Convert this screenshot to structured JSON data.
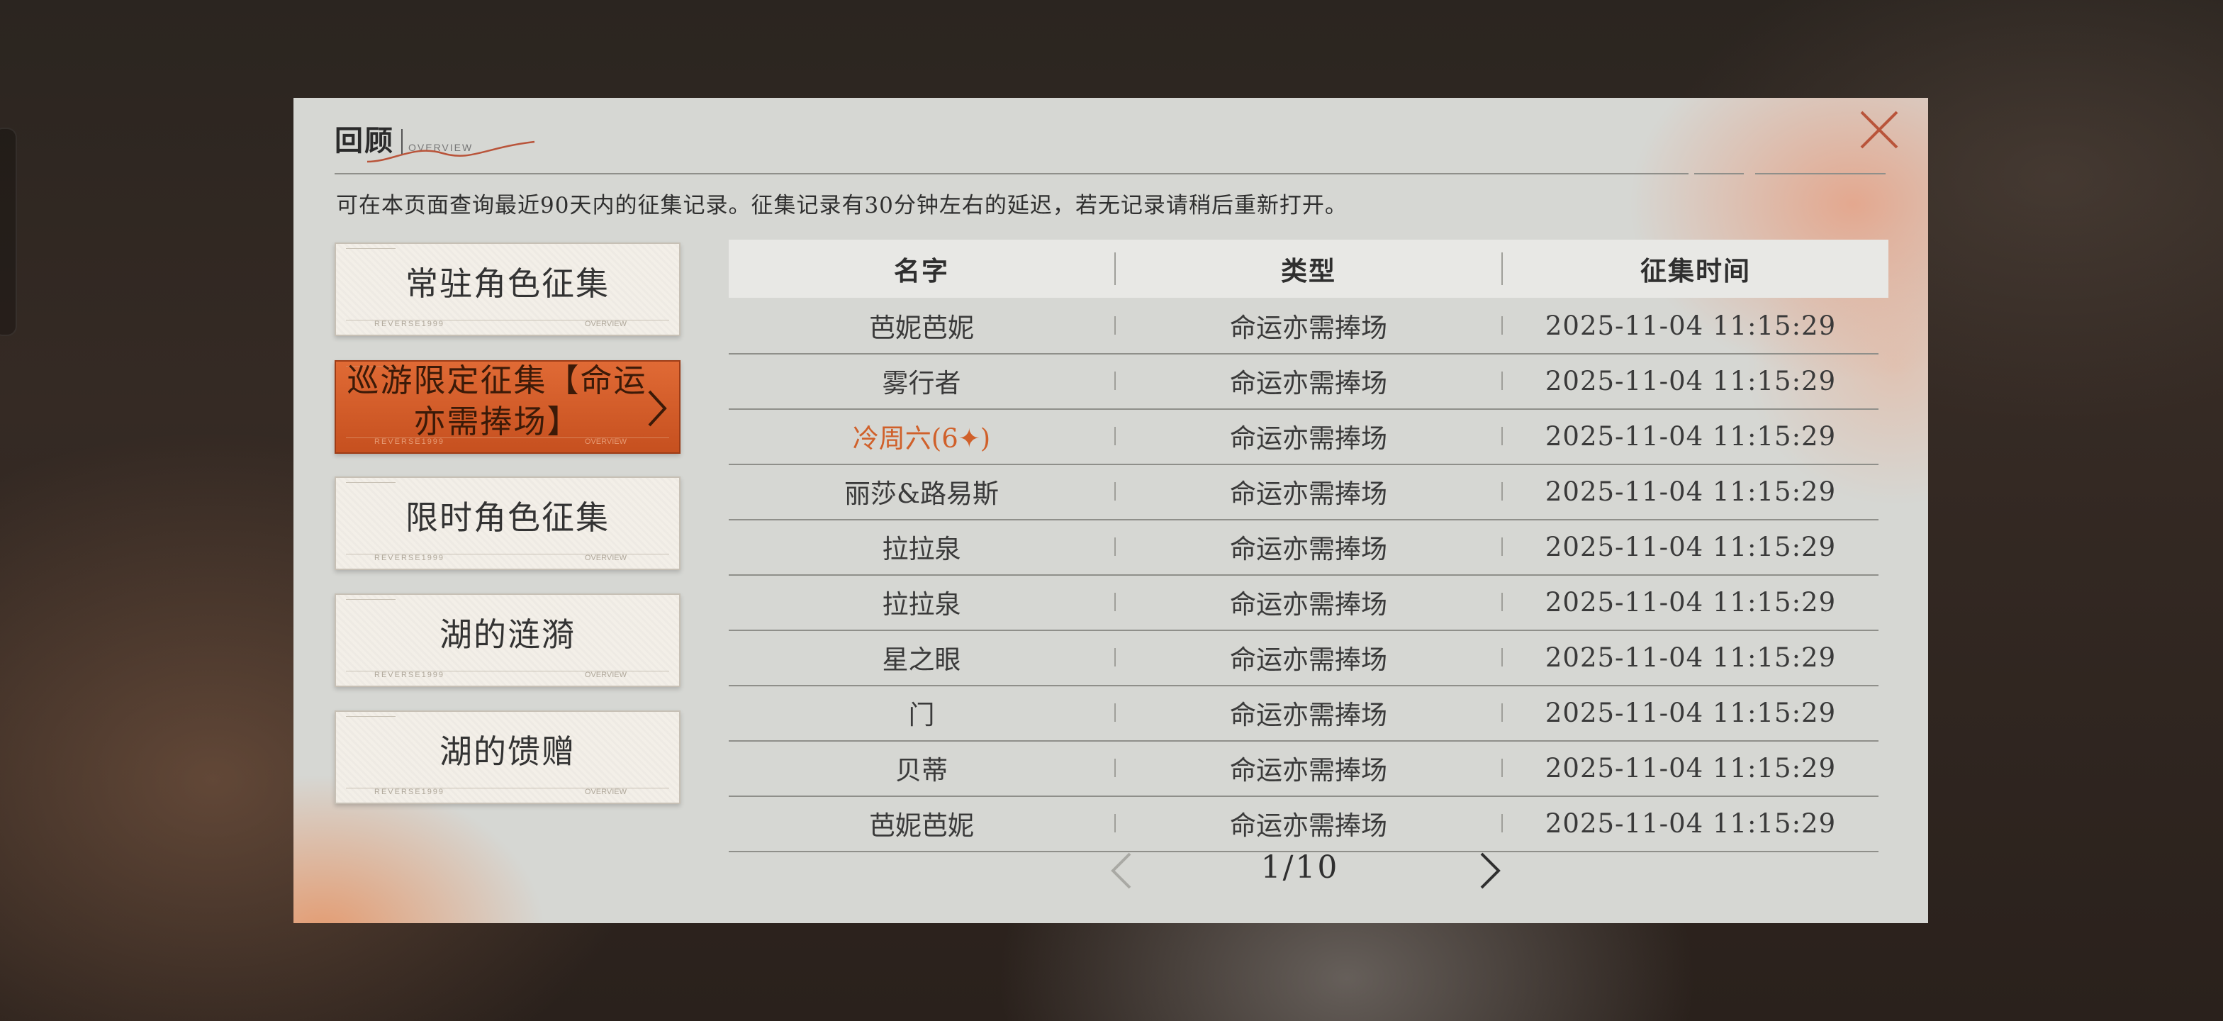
{
  "header": {
    "title": "回顾",
    "subtitle": "OVERVIEW",
    "notice": "可在本页面查询最近90天内的征集记录。征集记录有30分钟左右的延迟，若无记录请稍后重新打开。"
  },
  "tabs": [
    {
      "label": "常驻角色征集",
      "active": false
    },
    {
      "label": "巡游限定征集【命运亦需捧场】",
      "active": true
    },
    {
      "label": "限时角色征集",
      "active": false
    },
    {
      "label": "湖的涟漪",
      "active": false
    },
    {
      "label": "湖的馈赠",
      "active": false
    }
  ],
  "tab_footer": {
    "left": "REVERSE1999",
    "right": "OVERVIEW"
  },
  "table": {
    "columns": [
      "名字",
      "类型",
      "征集时间"
    ],
    "rows": [
      {
        "name": "芭妮芭妮",
        "type": "命运亦需捧场",
        "time": "2025-11-04 11:15:29",
        "highlight": false
      },
      {
        "name": "雾行者",
        "type": "命运亦需捧场",
        "time": "2025-11-04 11:15:29",
        "highlight": false
      },
      {
        "name": "冷周六(6✦)",
        "type": "命运亦需捧场",
        "time": "2025-11-04 11:15:29",
        "highlight": true
      },
      {
        "name": "丽莎&路易斯",
        "type": "命运亦需捧场",
        "time": "2025-11-04 11:15:29",
        "highlight": false
      },
      {
        "name": "拉拉泉",
        "type": "命运亦需捧场",
        "time": "2025-11-04 11:15:29",
        "highlight": false
      },
      {
        "name": "拉拉泉",
        "type": "命运亦需捧场",
        "time": "2025-11-04 11:15:29",
        "highlight": false
      },
      {
        "name": "星之眼",
        "type": "命运亦需捧场",
        "time": "2025-11-04 11:15:29",
        "highlight": false
      },
      {
        "name": "门",
        "type": "命运亦需捧场",
        "time": "2025-11-04 11:15:29",
        "highlight": false
      },
      {
        "name": "贝蒂",
        "type": "命运亦需捧场",
        "time": "2025-11-04 11:15:29",
        "highlight": false
      },
      {
        "name": "芭妮芭妮",
        "type": "命运亦需捧场",
        "time": "2025-11-04 11:15:29",
        "highlight": false
      }
    ]
  },
  "pagination": {
    "text": "1/10",
    "current": 1,
    "total": 10
  },
  "icons": {
    "close": "close-icon",
    "prev": "chevron-left-icon",
    "next": "chevron-right-icon"
  },
  "colors": {
    "accent": "#d0602a",
    "active_tab": "#c6501f",
    "panel": "#d6d7d3"
  }
}
